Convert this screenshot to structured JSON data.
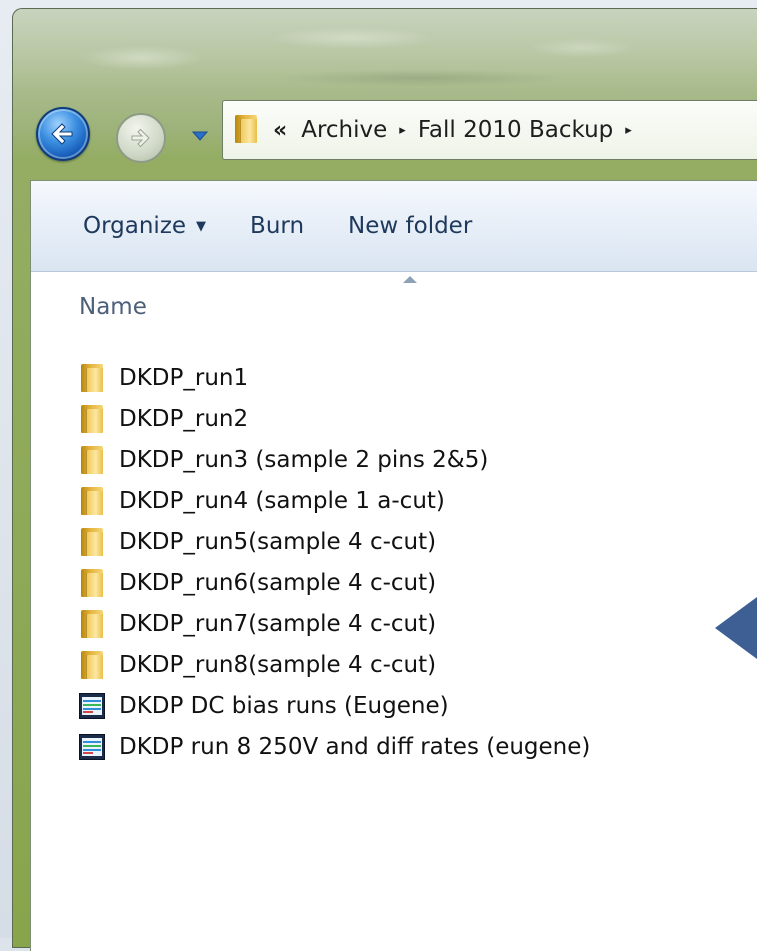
{
  "address_bar": {
    "overflow_glyph": "«",
    "crumbs": [
      "Archive",
      "Fall 2010 Backup"
    ],
    "separator_glyph": "▸"
  },
  "toolbar": {
    "organize_label": "Organize",
    "organize_arrow": "▼",
    "burn_label": "Burn",
    "new_folder_label": "New folder"
  },
  "columns": {
    "name_label": "Name"
  },
  "files": [
    {
      "name": "DKDP_run1",
      "icon": "folder-icon"
    },
    {
      "name": "DKDP_run2",
      "icon": "folder-icon"
    },
    {
      "name": "DKDP_run3 (sample 2 pins 2&5)",
      "icon": "folder-icon"
    },
    {
      "name": "DKDP_run4 (sample 1 a-cut)",
      "icon": "folder-icon"
    },
    {
      "name": "DKDP_run5(sample 4 c-cut)",
      "icon": "folder-icon"
    },
    {
      "name": "DKDP_run6(sample 4 c-cut)",
      "icon": "folder-icon"
    },
    {
      "name": "DKDP_run7(sample 4 c-cut)",
      "icon": "folder-icon"
    },
    {
      "name": "DKDP_run8(sample 4 c-cut)",
      "icon": "folder-icon"
    },
    {
      "name": "DKDP DC bias runs (Eugene)",
      "icon": "chart-document-icon"
    },
    {
      "name": "DKDP run 8 250V and diff rates (eugene)",
      "icon": "chart-document-icon"
    }
  ],
  "colors": {
    "window_frame": "#94ad63",
    "toolbar_text": "#1e395b",
    "pointer": "#3d5f93"
  }
}
